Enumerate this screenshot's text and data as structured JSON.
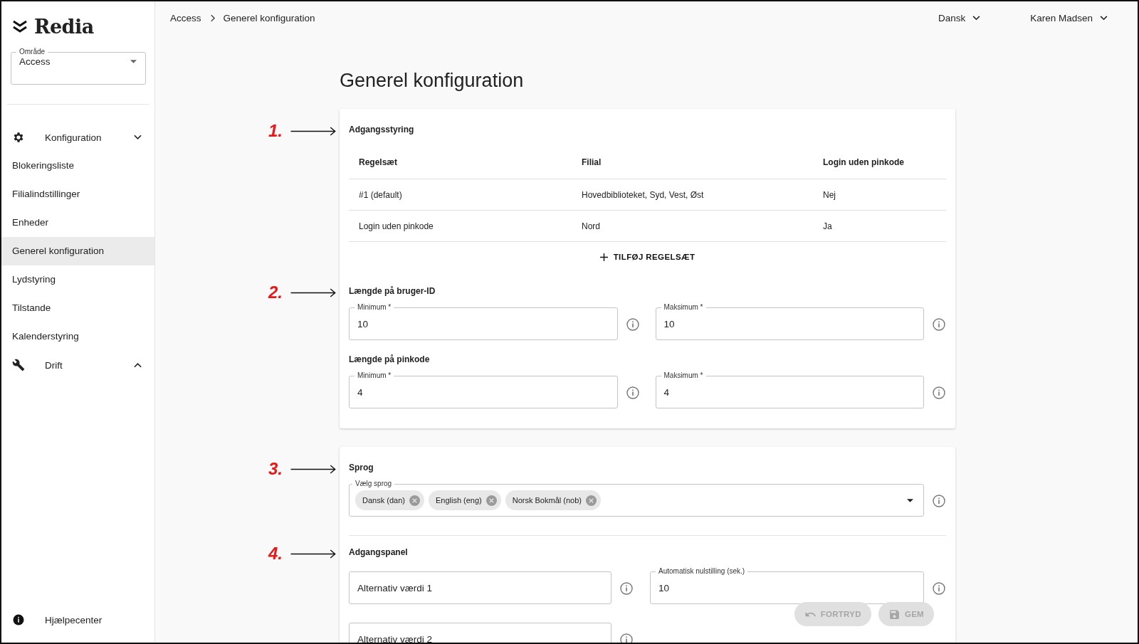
{
  "logo": {
    "text": "Redia"
  },
  "area_select": {
    "label": "Område",
    "value": "Access"
  },
  "sidebar": {
    "groups": [
      {
        "label": "Konfiguration",
        "expanded": true,
        "children": [
          {
            "label": "Blokeringsliste",
            "selected": false
          },
          {
            "label": "Filialindstillinger",
            "selected": false
          },
          {
            "label": "Enheder",
            "selected": false
          },
          {
            "label": "Generel konfiguration",
            "selected": true
          },
          {
            "label": "Lydstyring",
            "selected": false
          },
          {
            "label": "Tilstande",
            "selected": false
          },
          {
            "label": "Kalenderstyring",
            "selected": false
          }
        ]
      },
      {
        "label": "Drift",
        "expanded": false
      }
    ],
    "help": {
      "label": "Hjælpecenter"
    }
  },
  "breadcrumb": [
    "Access",
    "Generel konfiguration"
  ],
  "top_bar": {
    "language": "Dansk",
    "user": "Karen Madsen"
  },
  "page_title": "Generel konfiguration",
  "cards": [
    {
      "sections": [
        {
          "kind": "table",
          "annotation": "1.",
          "heading": "Adgangsstyring",
          "columns": [
            "Regelsæt",
            "Filial",
            "Login uden pinkode"
          ],
          "rows": [
            [
              "#1 (default)",
              "Hovedbiblioteket, Syd, Vest, Øst",
              "Nej"
            ],
            [
              "Login uden pinkode",
              "Nord",
              "Ja"
            ]
          ],
          "add_button": "TILFØJ REGELSÆT"
        },
        {
          "kind": "range",
          "annotation": "2.",
          "heading": "Længde på bruger-ID",
          "fields": [
            {
              "label": "Minimum *",
              "value": "10"
            },
            {
              "label": "Maksimum *",
              "value": "10"
            }
          ]
        },
        {
          "kind": "range",
          "heading": "Længde på pinkode",
          "fields": [
            {
              "label": "Minimum *",
              "value": "4"
            },
            {
              "label": "Maksimum *",
              "value": "4"
            }
          ]
        }
      ]
    },
    {
      "sections": [
        {
          "kind": "multiselect",
          "annotation": "3.",
          "heading": "Sprog",
          "label": "Vælg sprog",
          "chips": [
            "Dansk (dan)",
            "English (eng)",
            "Norsk Bokmål (nob)"
          ]
        },
        {
          "kind": "panel",
          "annotation": "4.",
          "heading": "Adgangspanel",
          "divider": true,
          "fields": [
            {
              "placeholder": "Alternativ værdi 1"
            },
            {
              "label": "Automatisk nulstilling (sek.)",
              "value": "10"
            },
            {
              "placeholder": "Alternativ værdi 2"
            }
          ]
        }
      ]
    }
  ],
  "actions": [
    {
      "label": "FORTRYD",
      "disabled": true
    },
    {
      "label": "GEM",
      "disabled": true
    }
  ]
}
